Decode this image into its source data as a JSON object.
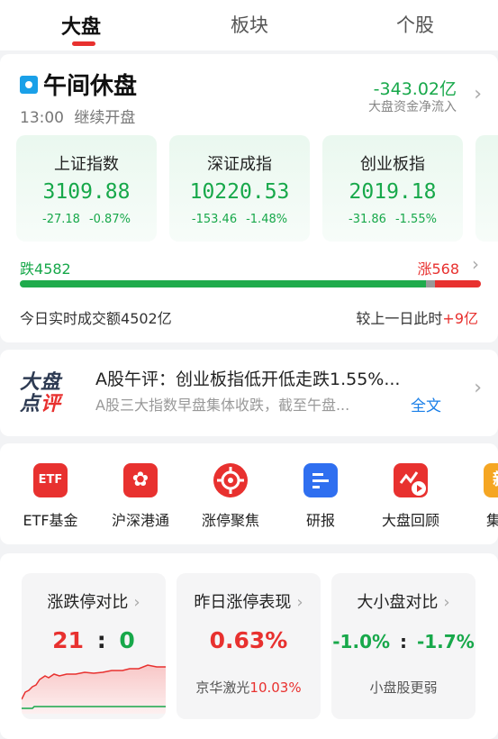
{
  "tabs": [
    {
      "label": "大盘",
      "active": true
    },
    {
      "label": "板块",
      "active": false
    },
    {
      "label": "个股",
      "active": false
    }
  ],
  "status": {
    "title": "午间休盘",
    "time": "13:00",
    "note": "继续开盘",
    "flow_value": "-343.02亿",
    "flow_label": "大盘资金净流入"
  },
  "indices": [
    {
      "name": "上证指数",
      "value": "3109.88",
      "change": "-27.18",
      "pct": "-0.87%"
    },
    {
      "name": "深证成指",
      "value": "10220.53",
      "change": "-153.46",
      "pct": "-1.48%"
    },
    {
      "name": "创业板指",
      "value": "2019.18",
      "change": "-31.86",
      "pct": "-1.55%"
    }
  ],
  "breadth": {
    "down_label": "跌",
    "down_count": "4582",
    "up_label": "涨",
    "up_count": "568",
    "down_fraction": 0.88,
    "flat_fraction": 0.02,
    "up_fraction": 0.1
  },
  "turnover": {
    "label": "今日实时成交额",
    "value": "4502亿",
    "compare_label": "较上一日此时",
    "compare_value": "+9亿"
  },
  "commentary": {
    "logo_line1": "大盘",
    "logo_line2a": "点",
    "logo_line2b": "评",
    "title": "A股午评：创业板指低开低走跌1.55%...",
    "summary": "A股三大指数早盘集体收跌，截至午盘...",
    "full_text_link": "全文"
  },
  "shortcuts": [
    {
      "label": "ETF基金",
      "icon": "etf-icon",
      "icon_text": "ETF",
      "color": "#e8312f"
    },
    {
      "label": "沪深港通",
      "icon": "hk-flag-icon",
      "icon_text": "✿",
      "color": "#e8312f"
    },
    {
      "label": "涨停聚焦",
      "icon": "target-icon",
      "icon_text": "",
      "color": "#e8312f"
    },
    {
      "label": "研报",
      "icon": "report-icon",
      "icon_text": "",
      "color": "#2f6ff0"
    },
    {
      "label": "大盘回顾",
      "icon": "video-replay-icon",
      "icon_text": "",
      "color": "#e8312f"
    },
    {
      "label": "集合",
      "icon": "auction-icon",
      "icon_text": "新",
      "color": "#f5a623"
    }
  ],
  "mini_cards": [
    {
      "title": "涨跌停对比",
      "value_up": "21",
      "value_sep": ":",
      "value_down": "0"
    },
    {
      "title": "昨日涨停表现",
      "value": "0.63%",
      "sub_name": "京华激光",
      "sub_value": "10.03%"
    },
    {
      "title": "大小盘对比",
      "value_big": "-1.0%",
      "value_sep": ":",
      "value_small": "-1.7%",
      "sub": "小盘股更弱"
    }
  ]
}
